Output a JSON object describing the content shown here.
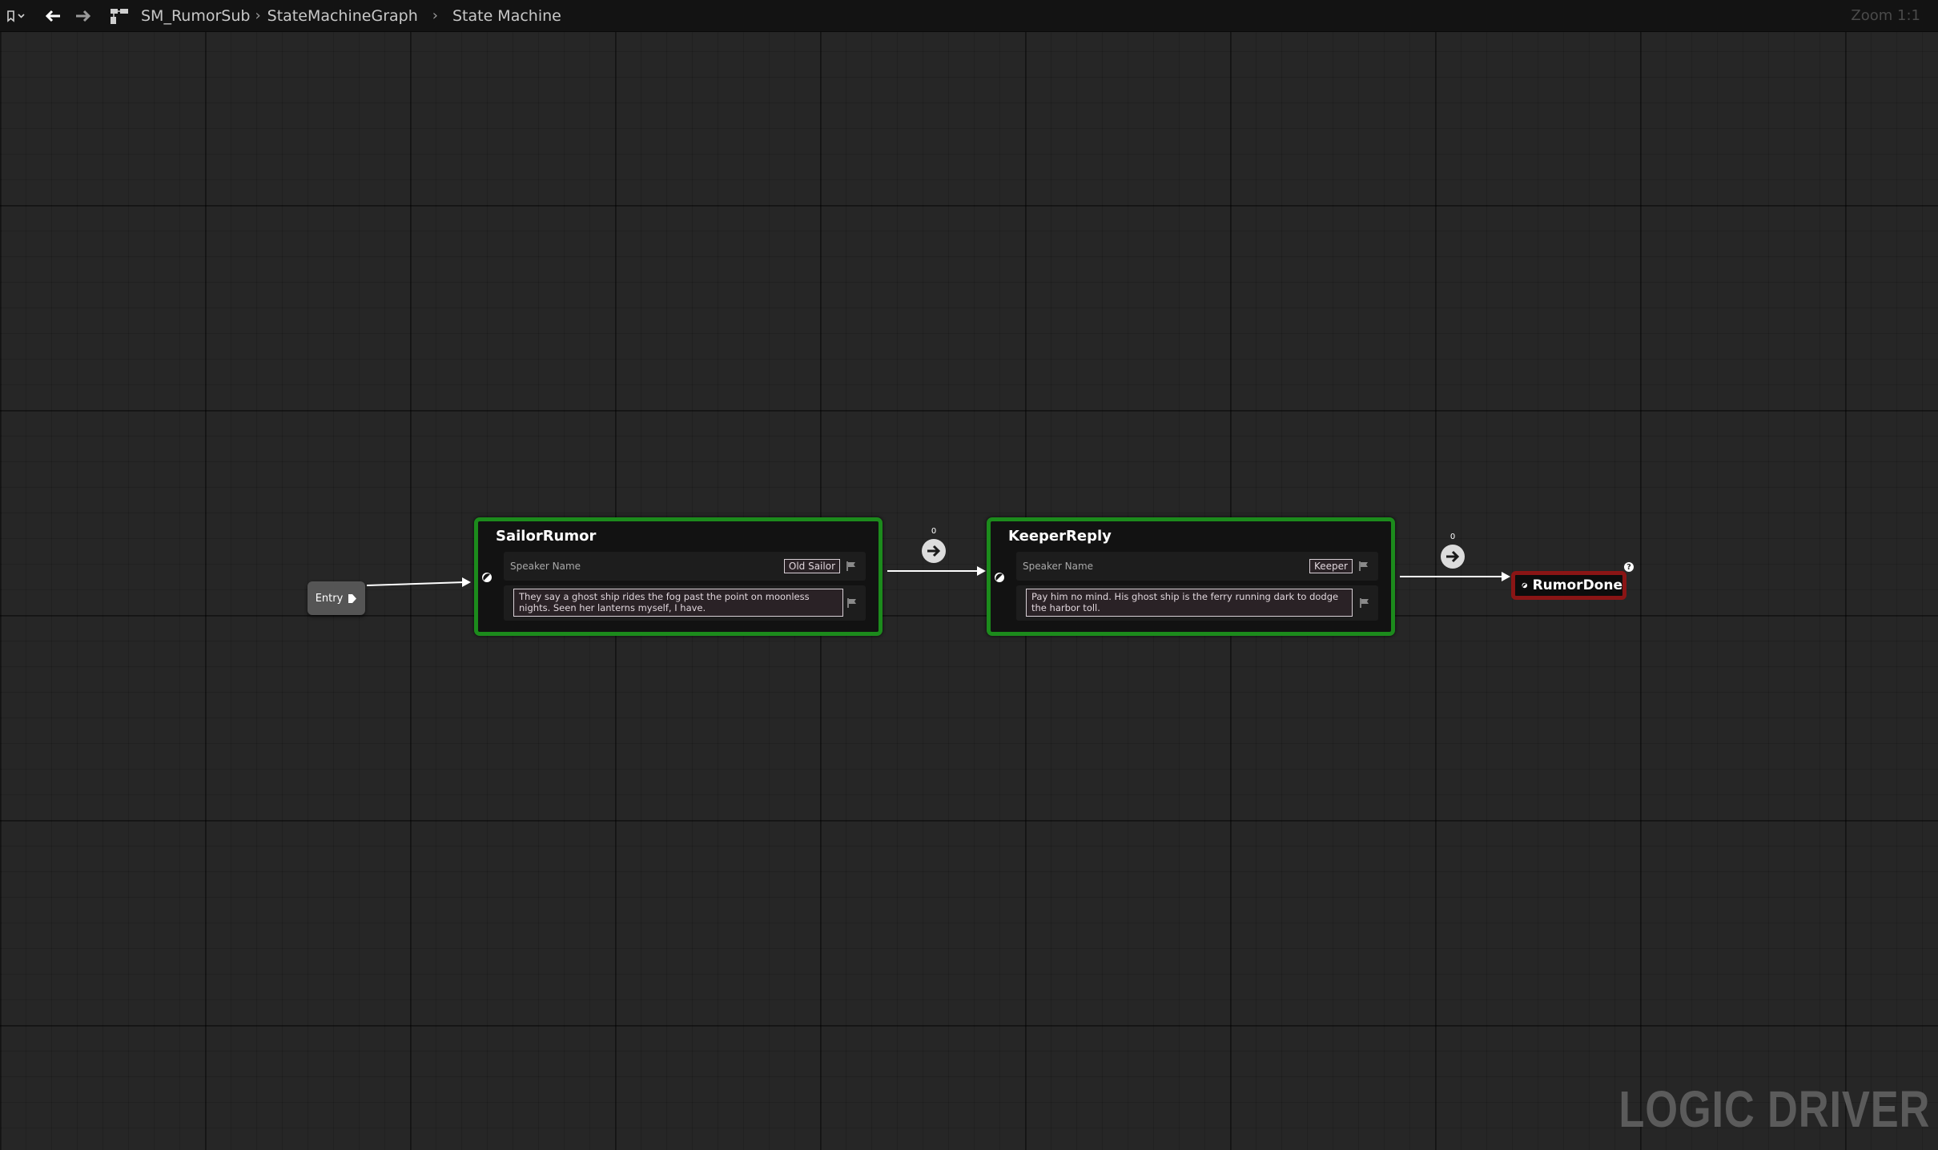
{
  "toolbar": {
    "breadcrumb": [
      "SM_RumorSub",
      "StateMachineGraph",
      "State Machine"
    ],
    "zoom": "Zoom 1:1"
  },
  "entry": {
    "label": "Entry"
  },
  "states": [
    {
      "title": "SailorRumor",
      "speaker_label": "Speaker Name",
      "speaker_value": "Old Sailor",
      "text": "They say a ghost ship rides the fog past the point on moonless nights. Seen her lanterns myself, I have."
    },
    {
      "title": "KeeperReply",
      "speaker_label": "Speaker Name",
      "speaker_value": "Keeper",
      "text": "Pay him no mind. His ghost ship is the ferry running dark to dodge the harbor toll."
    }
  ],
  "transitions": [
    {
      "priority": "0"
    },
    {
      "priority": "0"
    }
  ],
  "end_state": {
    "title": "RumorDone"
  },
  "watermark": "LOGIC DRIVER"
}
